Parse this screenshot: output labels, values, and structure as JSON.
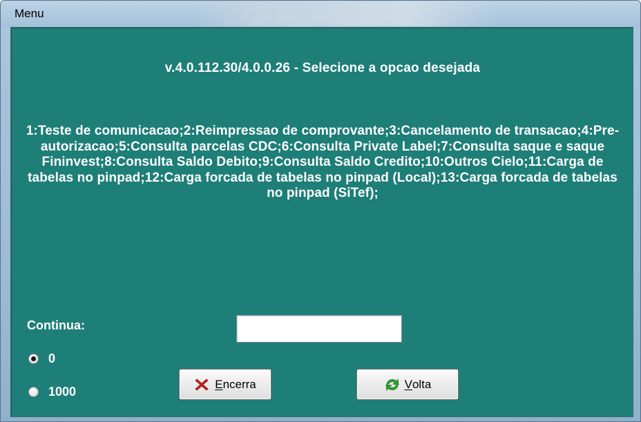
{
  "window": {
    "title": "Menu"
  },
  "dialog": {
    "heading": "v.4.0.112.30/4.0.0.26 - Selecione a opcao desejada",
    "options_text": "1:Teste de comunicacao;2:Reimpressao de comprovante;3:Cancelamento de transacao;4:Pre-autorizacao;5:Consulta parcelas CDC;6:Consulta Private Label;7:Consulta saque e saque Fininvest;8:Consulta Saldo Debito;9:Consulta Saldo Credito;10:Outros Cielo;11:Carga de tabelas no pinpad;12:Carga forcada de tabelas no pinpad (Local);13:Carga forcada de tabelas no pinpad (SiTef);",
    "continua_label": "Continua:",
    "continua_value": "",
    "radio_options": [
      {
        "label": "0",
        "checked": true
      },
      {
        "label": "1000",
        "checked": false
      }
    ],
    "buttons": {
      "encerra": {
        "mnemonic": "E",
        "rest": "ncerra",
        "icon": "close-x-icon"
      },
      "volta": {
        "mnemonic": "V",
        "rest": "olta",
        "icon": "refresh-icon"
      }
    }
  },
  "colors": {
    "dialog_background": "#1e7e78",
    "text": "#ffffff",
    "encerra_icon": "#cc1f1f",
    "volta_icon": "#2ca52c"
  }
}
